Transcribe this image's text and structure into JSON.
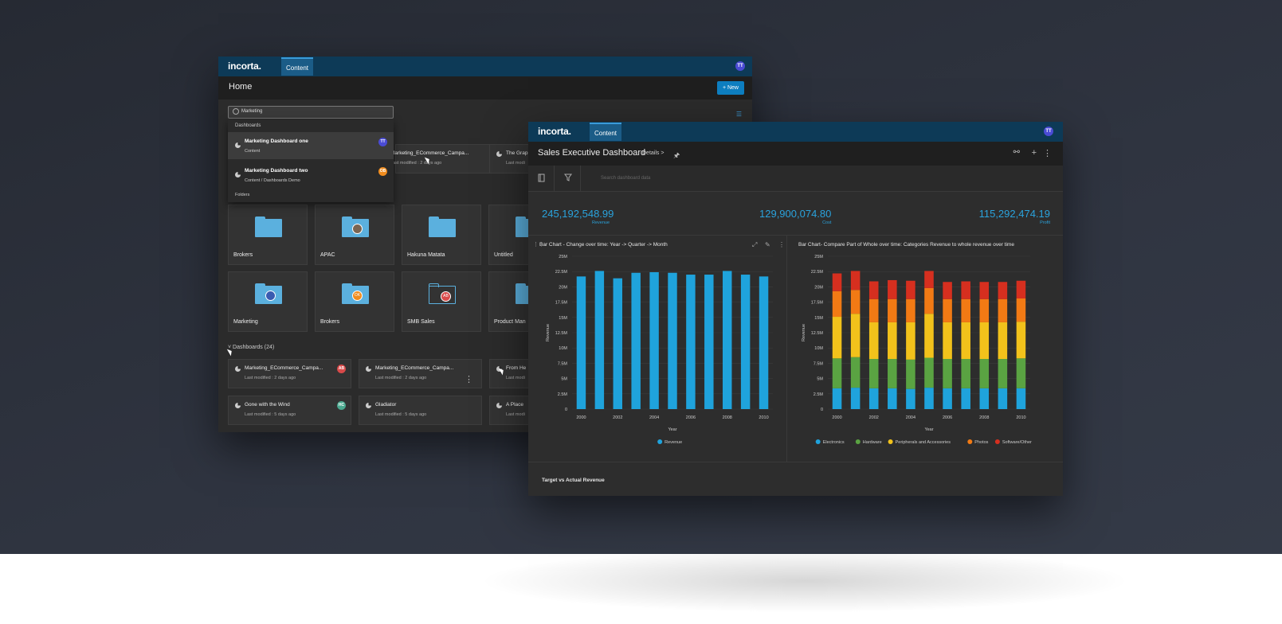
{
  "back_window": {
    "logo": "incorta.",
    "nav_tab": "Content",
    "user_initials": "TT",
    "page_title": "Home",
    "new_button": "+ New",
    "search": {
      "value": "Marketing"
    },
    "dropdown": {
      "section_dashboards": "Dashboards",
      "items": [
        {
          "name": "Marketing Dashboard one",
          "path": "Content",
          "owner": "TT"
        },
        {
          "name": "Marketing Dashboard two",
          "path": "Content / Dashboards Demo",
          "owner": "OB"
        }
      ],
      "section_folders": "Folders"
    },
    "top_cards": [
      {
        "name": "Marketing_ECommerce_Campa...",
        "meta": "Last modified : 2 days ago"
      },
      {
        "name": "The Grap",
        "meta": "Last modi"
      }
    ],
    "folders_row1": [
      {
        "name": "Brokers",
        "badge": ""
      },
      {
        "name": "APAC",
        "badge": "face"
      },
      {
        "name": "Hakuna Matata",
        "badge": ""
      },
      {
        "name": "Untitled",
        "badge": ""
      }
    ],
    "folders_row2": [
      {
        "name": "Marketing",
        "badge": "face"
      },
      {
        "name": "Brokers",
        "badge": "OK"
      },
      {
        "name": "SMB Sales",
        "badge": "AB"
      },
      {
        "name": "Product Man",
        "badge": ""
      }
    ],
    "dashboards_section": "Dashboards (24)",
    "dashboard_cards": [
      {
        "name": "Marketing_ECommerce_Campa...",
        "meta": "Last modified : 2 days ago",
        "owner": "AB"
      },
      {
        "name": "Marketing_ECommerce_Campa...",
        "meta": "Last modified : 2 days ago",
        "owner": ""
      },
      {
        "name": "From He",
        "meta": "Last modi",
        "owner": ""
      },
      {
        "name": "Gone with the Wind",
        "meta": "Last modified : 5 days ago",
        "owner": "HC"
      },
      {
        "name": "Gladiator",
        "meta": "Last modified : 5 days ago",
        "owner": ""
      },
      {
        "name": "A Place",
        "meta": "Last modi",
        "owner": ""
      }
    ]
  },
  "front_window": {
    "logo": "incorta.",
    "nav_tab": "Content",
    "user_initials": "TT",
    "title": "Sales Executive Dashboard",
    "details": "Details >",
    "search_placeholder": "Search dashboard data",
    "kpis": [
      {
        "value": "245,192,548.99",
        "label": "Revenue"
      },
      {
        "value": "129,900,074.80",
        "label": "Cost"
      },
      {
        "value": "115,292,474.19",
        "label": "Profit"
      }
    ],
    "bottom_title": "Target vs Actual Revenue"
  },
  "colors": {
    "brand_bar": "#0d3a57",
    "accent": "#2aa3dd",
    "series": [
      "#1fa3dc",
      "#5aa342",
      "#f2c21b",
      "#f27a14",
      "#d62f1f"
    ]
  },
  "chart_data": [
    {
      "type": "bar",
      "title": "Bar Chart - Change over time: Year -> Quarter -> Month",
      "xlabel": "Year",
      "ylabel": "Revenue",
      "ylim": [
        0,
        25000000
      ],
      "y_ticks": [
        "0",
        "2.5M",
        "5M",
        "7.5M",
        "10M",
        "12.5M",
        "15M",
        "17.5M",
        "20M",
        "22.5M",
        "25M"
      ],
      "x_tick_labels": [
        "2000",
        "2002",
        "2004",
        "2006",
        "2008",
        "2010"
      ],
      "categories": [
        "2000",
        "2001",
        "2002",
        "2003",
        "2004",
        "2005",
        "2006",
        "2007",
        "2008",
        "2009",
        "2010"
      ],
      "series": [
        {
          "name": "Revenue",
          "values": [
            21700000,
            22600000,
            21400000,
            22300000,
            22400000,
            22300000,
            22000000,
            22000000,
            22600000,
            22000000,
            21700000
          ]
        }
      ],
      "legend": "bottom"
    },
    {
      "type": "bar",
      "stacked": true,
      "title": "Bar Chart- Compare Part of Whole over time: Categories Revenue to whole revenue over time",
      "xlabel": "Year",
      "ylabel": "Revenue",
      "ylim": [
        0,
        25000000
      ],
      "y_ticks": [
        "0",
        "2.5M",
        "5M",
        "7.5M",
        "10M",
        "12.5M",
        "15M",
        "17.5M",
        "20M",
        "22.5M",
        "25M"
      ],
      "x_tick_labels": [
        "2000",
        "2002",
        "2004",
        "2006",
        "2008",
        "2010"
      ],
      "categories": [
        "2000",
        "2001",
        "2002",
        "2003",
        "2004",
        "2005",
        "2006",
        "2007",
        "2008",
        "2009",
        "2010"
      ],
      "series": [
        {
          "name": "Electronics",
          "values": [
            3400000,
            3500000,
            3400000,
            3400000,
            3300000,
            3500000,
            3400000,
            3400000,
            3400000,
            3400000,
            3400000
          ]
        },
        {
          "name": "Hardware",
          "values": [
            4900000,
            5000000,
            4800000,
            4800000,
            4800000,
            4900000,
            4800000,
            4800000,
            4800000,
            4800000,
            4900000
          ]
        },
        {
          "name": "Peripherals and Accessories",
          "values": [
            6800000,
            7100000,
            6000000,
            6000000,
            6100000,
            7200000,
            6000000,
            6000000,
            6000000,
            6000000,
            6000000
          ]
        },
        {
          "name": "Photos",
          "values": [
            4200000,
            3900000,
            3800000,
            3800000,
            3800000,
            4200000,
            3800000,
            3800000,
            3800000,
            3800000,
            3800000
          ]
        },
        {
          "name": "Software/Other",
          "values": [
            2900000,
            3100000,
            2900000,
            3100000,
            3000000,
            2800000,
            2800000,
            2900000,
            2800000,
            2800000,
            2900000
          ]
        }
      ],
      "legend": "bottom"
    }
  ]
}
